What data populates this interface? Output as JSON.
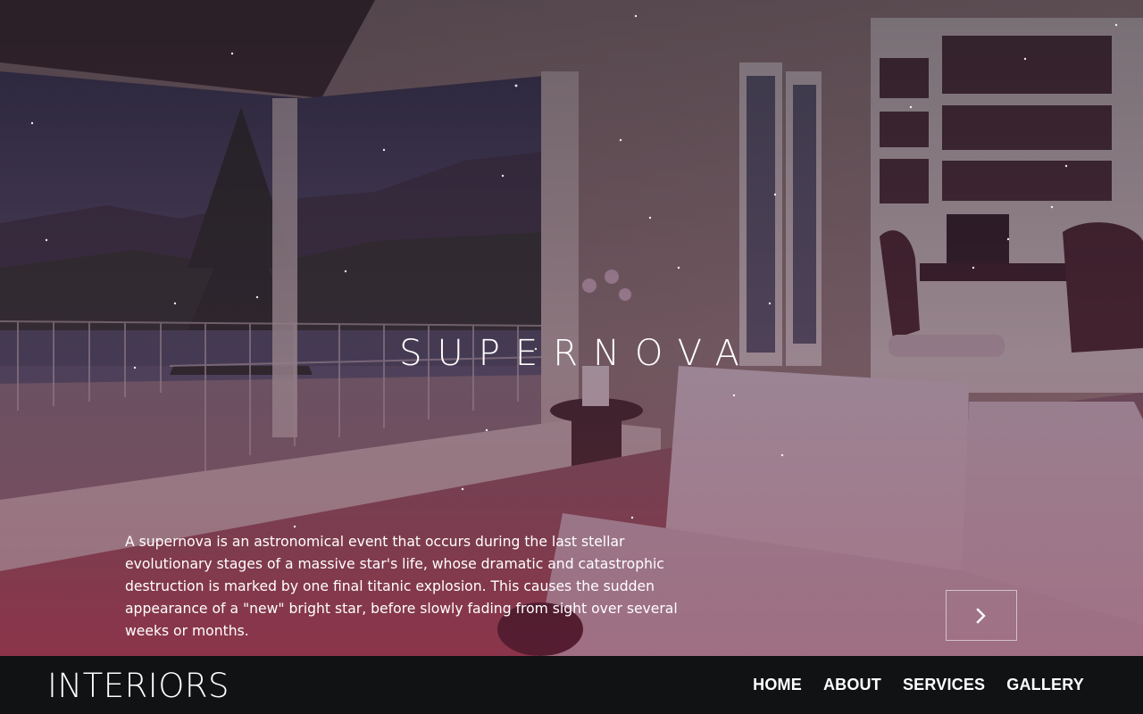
{
  "hero": {
    "title": "SUPERNOVA",
    "description": "A supernova is an astronomical event that occurs during the last stellar evolutionary stages of a massive star's life, whose dramatic and catastrophic destruction is marked by one final titanic explosion. This causes the sudden appearance of a \"new\" bright star, before slowly fading from sight over several weeks or months.",
    "next_icon": "chevron-right-icon"
  },
  "navbar": {
    "logo": "INTERIORS",
    "links": [
      {
        "label": "HOME"
      },
      {
        "label": "ABOUT"
      },
      {
        "label": "SERVICES"
      },
      {
        "label": "GALLERY"
      }
    ]
  },
  "colors": {
    "navbar_background": "#111214",
    "overlay_tint": "#6e1e3c",
    "text": "#ffffff"
  }
}
